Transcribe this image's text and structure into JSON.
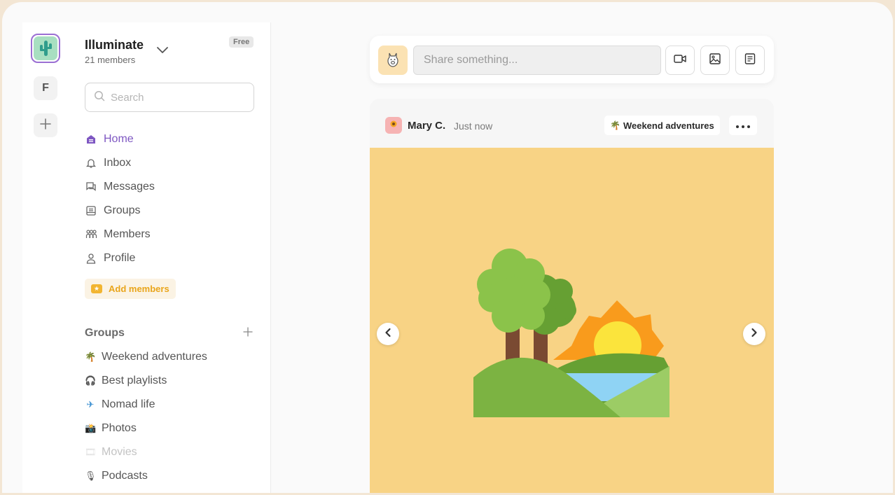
{
  "rail": {
    "workspace_icon": "cactus-icon",
    "items": [
      {
        "label": "F"
      },
      {
        "label": "+",
        "icon": "plus-icon"
      }
    ]
  },
  "workspace": {
    "name": "Illuminate",
    "members": "21 members",
    "plan": "Free"
  },
  "search": {
    "placeholder": "Search",
    "value": ""
  },
  "nav": [
    {
      "label": "Home",
      "icon": "home-icon",
      "active": true
    },
    {
      "label": "Inbox",
      "icon": "bell-icon"
    },
    {
      "label": "Messages",
      "icon": "messages-icon"
    },
    {
      "label": "Groups",
      "icon": "groups-icon"
    },
    {
      "label": "Members",
      "icon": "members-icon"
    },
    {
      "label": "Profile",
      "icon": "profile-icon"
    }
  ],
  "add_members": {
    "label": "Add members",
    "icon": "star-icon"
  },
  "groups": {
    "title": "Groups",
    "items": [
      {
        "label": "Weekend adventures",
        "emoji": "🌴"
      },
      {
        "label": "Best playlists",
        "emoji": "🎧"
      },
      {
        "label": "Nomad life",
        "emoji": "✈"
      },
      {
        "label": "Photos",
        "emoji": "📸"
      },
      {
        "label": "Movies",
        "emoji": "🎞",
        "muted": true
      },
      {
        "label": "Podcasts",
        "emoji": "🎙"
      }
    ]
  },
  "composer": {
    "placeholder": "Share something...",
    "value": "",
    "avatar_icon": "llama-avatar-icon",
    "tools": [
      "video-icon",
      "image-icon",
      "document-icon"
    ]
  },
  "post": {
    "author": "Mary C.",
    "time": "Just now",
    "group": {
      "label": "Weekend adventures",
      "emoji": "🌴"
    },
    "image_icon": "landscape-illustration",
    "colors": {
      "image_bg": "#f8d385",
      "accent": "#7e57c2",
      "highlight": "#e9a51b"
    }
  }
}
